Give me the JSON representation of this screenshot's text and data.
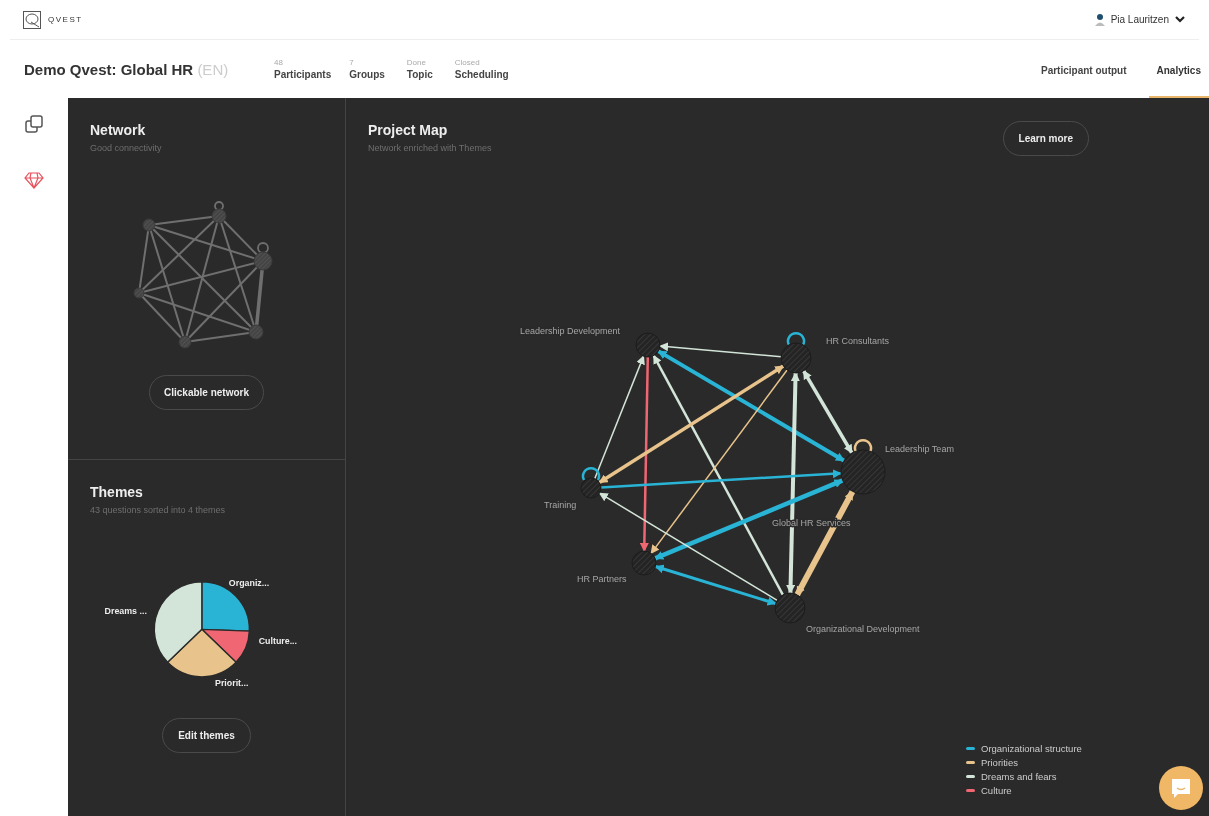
{
  "app": {
    "logo_text": "QVEST"
  },
  "user": {
    "name": "Pia Lauritzen"
  },
  "project": {
    "title": "Demo Qvest: Global HR",
    "language": "(EN)"
  },
  "steps": [
    {
      "value": "48",
      "label": "Participants"
    },
    {
      "value": "7",
      "label": "Groups"
    },
    {
      "value": "Done",
      "label": "Topic"
    },
    {
      "value": "Closed",
      "label": "Scheduling"
    }
  ],
  "tabs": [
    {
      "label": "Participant output",
      "selected": false
    },
    {
      "label": "Analytics",
      "selected": true
    }
  ],
  "sidebar": {
    "items": [
      {
        "kind": "copy",
        "selected": false
      },
      {
        "kind": "diamond",
        "selected": true
      }
    ]
  },
  "network": {
    "title": "Network",
    "subtitle": "Good connectivity",
    "button": "Clickable network"
  },
  "themes": {
    "title": "Themes",
    "subtitle": "43 questions sorted into 4 themes",
    "button": "Edit themes",
    "slices": [
      {
        "label": "Organiz...",
        "color": "#29b4d6"
      },
      {
        "label": "Culture...",
        "color": "#f06672"
      },
      {
        "label": "Priorit...",
        "color": "#e8c48c"
      },
      {
        "label": "Dreams ...",
        "color": "#d3e4d8"
      }
    ]
  },
  "project_map": {
    "title": "Project Map",
    "subtitle": "Network enriched with Themes",
    "button": "Learn more",
    "nodes": [
      {
        "label": "Leadership Development"
      },
      {
        "label": "HR Consultants"
      },
      {
        "label": "Leadership Team"
      },
      {
        "label": "Training"
      },
      {
        "label": "Global HR Services"
      },
      {
        "label": "HR Partners"
      },
      {
        "label": "Organizational Development"
      }
    ],
    "legend": [
      {
        "label": "Organizational structure",
        "color": "#29b4d6"
      },
      {
        "label": "Priorities",
        "color": "#e8c48c"
      },
      {
        "label": "Dreams and fears",
        "color": "#d3e4d8"
      },
      {
        "label": "Culture",
        "color": "#f06672"
      }
    ]
  }
}
